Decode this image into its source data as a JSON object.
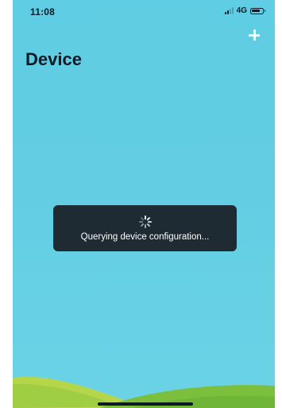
{
  "status_bar": {
    "time": "11:08",
    "network": "4G",
    "signal_icon": "signal-bars-icon",
    "battery_icon": "battery-icon"
  },
  "header": {
    "title": "Device",
    "add_icon": "plus-icon"
  },
  "toast": {
    "icon": "loading-spinner-icon",
    "message": "Querying device configuration..."
  },
  "colors": {
    "background": "#62cde3",
    "toast_background": "#1f2b33",
    "hill_light": "#b6d64a",
    "hill_dark": "#7cbf3c"
  }
}
